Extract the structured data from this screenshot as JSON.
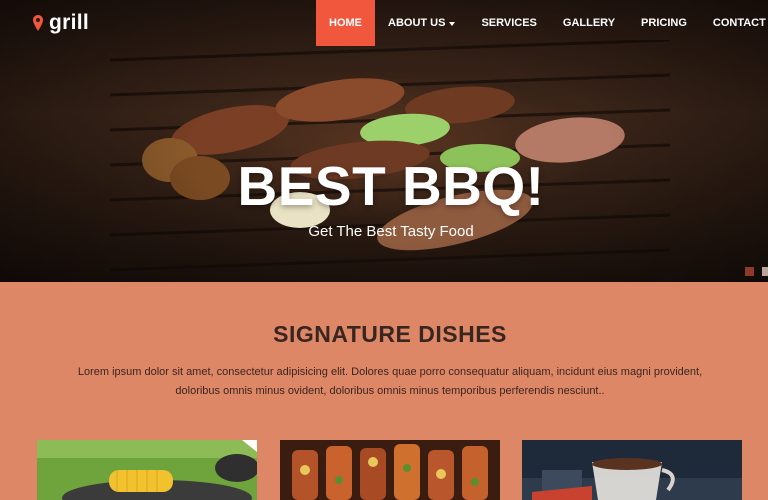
{
  "brand": {
    "name": "grill",
    "icon": "map-pin-icon",
    "accent": "#f0573d"
  },
  "nav": {
    "items": [
      {
        "label": "HOME",
        "active": true
      },
      {
        "label": "ABOUT US",
        "dropdown": true
      },
      {
        "label": "SERVICES"
      },
      {
        "label": "GALLERY"
      },
      {
        "label": "PRICING"
      },
      {
        "label": "CONTACT"
      }
    ]
  },
  "hero": {
    "title": "BEST BBQ!",
    "subtitle": "Get The Best Tasty Food",
    "slides_total": 2,
    "active_slide": 1
  },
  "signature": {
    "title": "SIGNATURE DISHES",
    "text_line1": "Lorem ipsum dolor sit amet, consectetur adipisicing elit. Dolores quae porro consequatur aliquam, incidunt eius magni provident,",
    "text_line2": "doloribus omnis minus ovident, doloribus omnis minus temporibus perferendis nesciunt.."
  },
  "colors": {
    "section_bg": "#de8766",
    "heading": "#3a2620",
    "nav_active": "#f0573d"
  }
}
